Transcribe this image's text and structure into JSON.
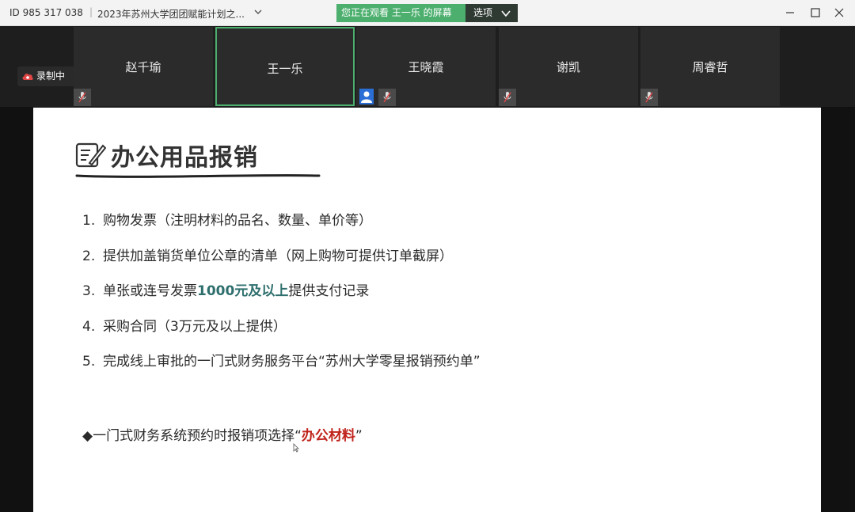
{
  "window": {
    "meeting_id": "ID 985 317 038",
    "separator": "|",
    "meeting_title": "2023年苏州大学团团赋能计划之...",
    "viewing_banner": "您正在观看 王一乐 的屏幕",
    "options_label": "选项"
  },
  "recording": {
    "label": "录制中"
  },
  "participants": [
    {
      "name": "赵千瑜"
    },
    {
      "name": "王一乐"
    },
    {
      "name": "王晓霞"
    },
    {
      "name": "谢凯"
    },
    {
      "name": "周睿哲"
    }
  ],
  "slide": {
    "title": "办公用品报销",
    "items": [
      {
        "num": "1.",
        "text": "购物发票（注明材料的品名、数量、单价等）"
      },
      {
        "num": "2.",
        "text": "提供加盖销货单位公章的清单（网上购物可提供订单截屏）"
      },
      {
        "num": "3.",
        "pre": "单张或连号发票",
        "highlight": "1000元及以上",
        "post": "提供支付记录"
      },
      {
        "num": "4.",
        "text": "采购合同（3万元及以上提供）"
      },
      {
        "num": "5.",
        "text": "完成线上审批的一门式财务服务平台“苏州大学零星报销预约单”"
      }
    ],
    "bullet": {
      "pre": "◆一门式财务系统预约时报销项选择“",
      "highlight": "办公材料",
      "post": "”"
    }
  },
  "colors": {
    "active_border": "#4caf6e",
    "banner_bg": "#4caf6e",
    "teal_highlight": "#2e6f6d",
    "red_highlight": "#c0231b"
  }
}
